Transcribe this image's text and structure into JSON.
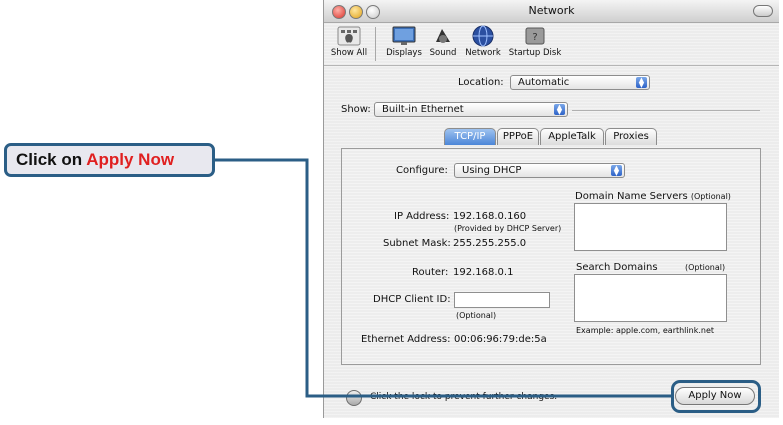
{
  "window": {
    "title": "Network"
  },
  "toolbar": {
    "items": [
      {
        "label": "Show All",
        "icon": "apple-icon"
      },
      {
        "label": "Displays",
        "icon": "displays-icon"
      },
      {
        "label": "Sound",
        "icon": "sound-icon"
      },
      {
        "label": "Network",
        "icon": "network-globe-icon"
      },
      {
        "label": "Startup Disk",
        "icon": "startup-disk-icon"
      }
    ]
  },
  "location": {
    "label": "Location:",
    "value": "Automatic"
  },
  "show": {
    "label": "Show:",
    "value": "Built-in Ethernet"
  },
  "tabs": [
    {
      "label": "TCP/IP",
      "selected": true
    },
    {
      "label": "PPPoE",
      "selected": false
    },
    {
      "label": "AppleTalk",
      "selected": false
    },
    {
      "label": "Proxies",
      "selected": false
    }
  ],
  "tcpip": {
    "configure_label": "Configure:",
    "configure_value": "Using DHCP",
    "ip_label": "IP Address:",
    "ip_value": "192.168.0.160",
    "ip_note": "(Provided by DHCP Server)",
    "subnet_label": "Subnet Mask:",
    "subnet_value": "255.255.255.0",
    "router_label": "Router:",
    "router_value": "192.168.0.1",
    "dhcp_label": "DHCP Client ID:",
    "dhcp_value": "",
    "dhcp_note": "(Optional)",
    "ethernet_label": "Ethernet Address:",
    "ethernet_value": "00:06:96:79:de:5a",
    "dns_label": "Domain Name Servers",
    "dns_optional": "(Optional)",
    "search_label": "Search Domains",
    "search_optional": "(Optional)",
    "example": "Example: apple.com, earthlink.net"
  },
  "footer": {
    "lock_text": "Click the lock to prevent further changes.",
    "apply_label": "Apply Now"
  },
  "callout": {
    "prefix": "Click on ",
    "highlight": "Apply Now"
  },
  "colors": {
    "callout_border": "#2b5e86",
    "callout_highlight": "#e02020",
    "tab_selected": "#4c86d8"
  }
}
